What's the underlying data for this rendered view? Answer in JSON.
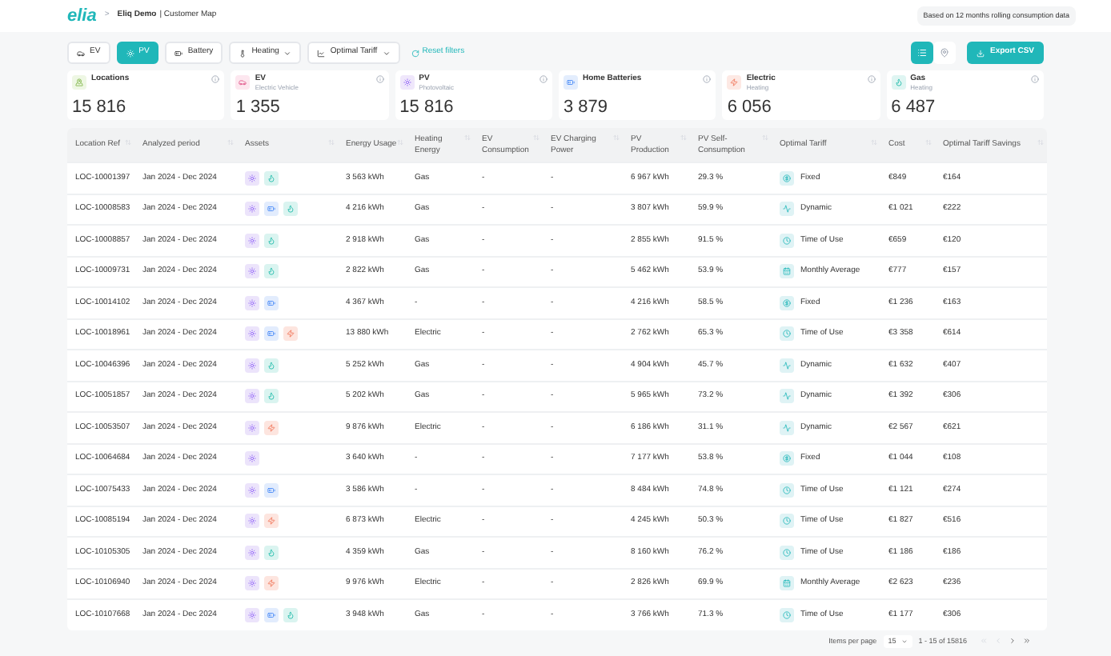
{
  "header": {
    "logo": "elia",
    "breadcrumb_separator": ">",
    "breadcrumb_bold": "Eliq Demo",
    "breadcrumb_rest": "| Customer Map",
    "note": "Based on 12 months rolling consumption data"
  },
  "filters": [
    {
      "kind": "car",
      "label": "EV",
      "selected": false,
      "dropdown": false
    },
    {
      "kind": "sun",
      "label": "PV",
      "selected": true,
      "dropdown": false
    },
    {
      "kind": "battery",
      "label": "Battery",
      "selected": false,
      "dropdown": false
    },
    {
      "kind": "heat",
      "label": "Heating",
      "selected": false,
      "dropdown": true
    },
    {
      "kind": "chart",
      "label": "Optimal Tariff",
      "selected": false,
      "dropdown": true
    }
  ],
  "reset_filters": "Reset filters",
  "view_toggle": [
    {
      "kind": "list",
      "selected": true
    },
    {
      "kind": "map",
      "selected": false
    }
  ],
  "export_button": "Export CSV",
  "kpis": [
    {
      "kind": "location",
      "title": "Locations",
      "value": "15 816"
    },
    {
      "kind": "ev",
      "title": "EV",
      "subtitle": "Electric Vehicle",
      "value": "1 355"
    },
    {
      "kind": "pv",
      "title": "PV",
      "subtitle": "Photovoltaic",
      "value": "15 816"
    },
    {
      "kind": "battery",
      "title": "Home Batteries",
      "value": "3 879"
    },
    {
      "kind": "electric",
      "title": "Electric",
      "subtitle": "Heating",
      "value": "6 056"
    },
    {
      "kind": "gas",
      "title": "Gas",
      "subtitle": "Heating",
      "value": "6 487"
    }
  ],
  "table": {
    "columns": [
      "Location Ref",
      "Analyzed period",
      "Assets",
      "Energy Usage",
      "Heating Energy",
      "EV Consumption",
      "EV Charging Power",
      "PV Production",
      "PV Self-Consumption",
      "Optimal Tariff",
      "Cost",
      "Optimal Tariff Savings"
    ],
    "rows": [
      {
        "ref": "LOC-10001397",
        "period": "Jan 2024 - Dec 2024",
        "assets": [
          {
            "kind": "pv"
          },
          {
            "kind": "gas"
          }
        ],
        "usage": "3 563 kWh",
        "heating": "Gas",
        "ev_consumption": "-",
        "ev_power": "-",
        "pv_production": "6 967 kWh",
        "self_consumption": "29.3 %",
        "tariff": {
          "kind": "fixed",
          "label": "Fixed"
        },
        "cost": "€849",
        "savings": "€164"
      },
      {
        "ref": "LOC-10008583",
        "period": "Jan 2024 - Dec 2024",
        "assets": [
          {
            "kind": "pv"
          },
          {
            "kind": "battery"
          },
          {
            "kind": "gas"
          }
        ],
        "usage": "4 216 kWh",
        "heating": "Gas",
        "ev_consumption": "-",
        "ev_power": "-",
        "pv_production": "3 807 kWh",
        "self_consumption": "59.9 %",
        "tariff": {
          "kind": "dynamic",
          "label": "Dynamic"
        },
        "cost": "€1 021",
        "savings": "€222"
      },
      {
        "ref": "LOC-10008857",
        "period": "Jan 2024 - Dec 2024",
        "assets": [
          {
            "kind": "pv"
          },
          {
            "kind": "gas"
          }
        ],
        "usage": "2 918 kWh",
        "heating": "Gas",
        "ev_consumption": "-",
        "ev_power": "-",
        "pv_production": "2 855 kWh",
        "self_consumption": "91.5 %",
        "tariff": {
          "kind": "time",
          "label": "Time of Use"
        },
        "cost": "€659",
        "savings": "€120"
      },
      {
        "ref": "LOC-10009731",
        "period": "Jan 2024 - Dec 2024",
        "assets": [
          {
            "kind": "pv"
          },
          {
            "kind": "gas"
          }
        ],
        "usage": "2 822 kWh",
        "heating": "Gas",
        "ev_consumption": "-",
        "ev_power": "-",
        "pv_production": "5 462 kWh",
        "self_consumption": "53.9 %",
        "tariff": {
          "kind": "monthly",
          "label": "Monthly Average"
        },
        "cost": "€777",
        "savings": "€157"
      },
      {
        "ref": "LOC-10014102",
        "period": "Jan 2024 - Dec 2024",
        "assets": [
          {
            "kind": "pv"
          },
          {
            "kind": "battery"
          }
        ],
        "usage": "4 367 kWh",
        "heating": "-",
        "ev_consumption": "-",
        "ev_power": "-",
        "pv_production": "4 216 kWh",
        "self_consumption": "58.5 %",
        "tariff": {
          "kind": "fixed",
          "label": "Fixed"
        },
        "cost": "€1 236",
        "savings": "€163"
      },
      {
        "ref": "LOC-10018961",
        "period": "Jan 2024 - Dec 2024",
        "assets": [
          {
            "kind": "pv"
          },
          {
            "kind": "battery"
          },
          {
            "kind": "electric"
          }
        ],
        "usage": "13 880 kWh",
        "heating": "Electric",
        "ev_consumption": "-",
        "ev_power": "-",
        "pv_production": "2 762 kWh",
        "self_consumption": "65.3 %",
        "tariff": {
          "kind": "time",
          "label": "Time of Use"
        },
        "cost": "€3 358",
        "savings": "€614"
      },
      {
        "ref": "LOC-10046396",
        "period": "Jan 2024 - Dec 2024",
        "assets": [
          {
            "kind": "pv"
          },
          {
            "kind": "gas"
          }
        ],
        "usage": "5 252 kWh",
        "heating": "Gas",
        "ev_consumption": "-",
        "ev_power": "-",
        "pv_production": "4 904 kWh",
        "self_consumption": "45.7 %",
        "tariff": {
          "kind": "dynamic",
          "label": "Dynamic"
        },
        "cost": "€1 632",
        "savings": "€407"
      },
      {
        "ref": "LOC-10051857",
        "period": "Jan 2024 - Dec 2024",
        "assets": [
          {
            "kind": "pv"
          },
          {
            "kind": "gas"
          }
        ],
        "usage": "5 202 kWh",
        "heating": "Gas",
        "ev_consumption": "-",
        "ev_power": "-",
        "pv_production": "5 965 kWh",
        "self_consumption": "73.2 %",
        "tariff": {
          "kind": "dynamic",
          "label": "Dynamic"
        },
        "cost": "€1 392",
        "savings": "€306"
      },
      {
        "ref": "LOC-10053507",
        "period": "Jan 2024 - Dec 2024",
        "assets": [
          {
            "kind": "pv"
          },
          {
            "kind": "electric"
          }
        ],
        "usage": "9 876 kWh",
        "heating": "Electric",
        "ev_consumption": "-",
        "ev_power": "-",
        "pv_production": "6 186 kWh",
        "self_consumption": "31.1 %",
        "tariff": {
          "kind": "dynamic",
          "label": "Dynamic"
        },
        "cost": "€2 567",
        "savings": "€621"
      },
      {
        "ref": "LOC-10064684",
        "period": "Jan 2024 - Dec 2024",
        "assets": [
          {
            "kind": "pv"
          }
        ],
        "usage": "3 640 kWh",
        "heating": "-",
        "ev_consumption": "-",
        "ev_power": "-",
        "pv_production": "7 177 kWh",
        "self_consumption": "53.8 %",
        "tariff": {
          "kind": "fixed",
          "label": "Fixed"
        },
        "cost": "€1 044",
        "savings": "€108"
      },
      {
        "ref": "LOC-10075433",
        "period": "Jan 2024 - Dec 2024",
        "assets": [
          {
            "kind": "pv"
          },
          {
            "kind": "battery"
          }
        ],
        "usage": "3 586 kWh",
        "heating": "-",
        "ev_consumption": "-",
        "ev_power": "-",
        "pv_production": "8 484 kWh",
        "self_consumption": "74.8 %",
        "tariff": {
          "kind": "time",
          "label": "Time of Use"
        },
        "cost": "€1 121",
        "savings": "€274"
      },
      {
        "ref": "LOC-10085194",
        "period": "Jan 2024 - Dec 2024",
        "assets": [
          {
            "kind": "pv"
          },
          {
            "kind": "electric"
          }
        ],
        "usage": "6 873 kWh",
        "heating": "Electric",
        "ev_consumption": "-",
        "ev_power": "-",
        "pv_production": "4 245 kWh",
        "self_consumption": "50.3 %",
        "tariff": {
          "kind": "time",
          "label": "Time of Use"
        },
        "cost": "€1 827",
        "savings": "€516"
      },
      {
        "ref": "LOC-10105305",
        "period": "Jan 2024 - Dec 2024",
        "assets": [
          {
            "kind": "pv"
          },
          {
            "kind": "gas"
          }
        ],
        "usage": "4 359 kWh",
        "heating": "Gas",
        "ev_consumption": "-",
        "ev_power": "-",
        "pv_production": "8 160 kWh",
        "self_consumption": "76.2 %",
        "tariff": {
          "kind": "time",
          "label": "Time of Use"
        },
        "cost": "€1 186",
        "savings": "€186"
      },
      {
        "ref": "LOC-10106940",
        "period": "Jan 2024 - Dec 2024",
        "assets": [
          {
            "kind": "pv"
          },
          {
            "kind": "electric"
          }
        ],
        "usage": "9 976 kWh",
        "heating": "Electric",
        "ev_consumption": "-",
        "ev_power": "-",
        "pv_production": "2 826 kWh",
        "self_consumption": "69.9 %",
        "tariff": {
          "kind": "monthly",
          "label": "Monthly Average"
        },
        "cost": "€2 623",
        "savings": "€236"
      },
      {
        "ref": "LOC-10107668",
        "period": "Jan 2024 - Dec 2024",
        "assets": [
          {
            "kind": "pv"
          },
          {
            "kind": "battery"
          },
          {
            "kind": "gas"
          }
        ],
        "usage": "3 948 kWh",
        "heating": "Gas",
        "ev_consumption": "-",
        "ev_power": "-",
        "pv_production": "3 766 kWh",
        "self_consumption": "71.3 %",
        "tariff": {
          "kind": "time",
          "label": "Time of Use"
        },
        "cost": "€1 177",
        "savings": "€306"
      }
    ]
  },
  "pagination": {
    "label": "Items per page",
    "page_size": "15",
    "range": "1 - 15 of 15816"
  }
}
